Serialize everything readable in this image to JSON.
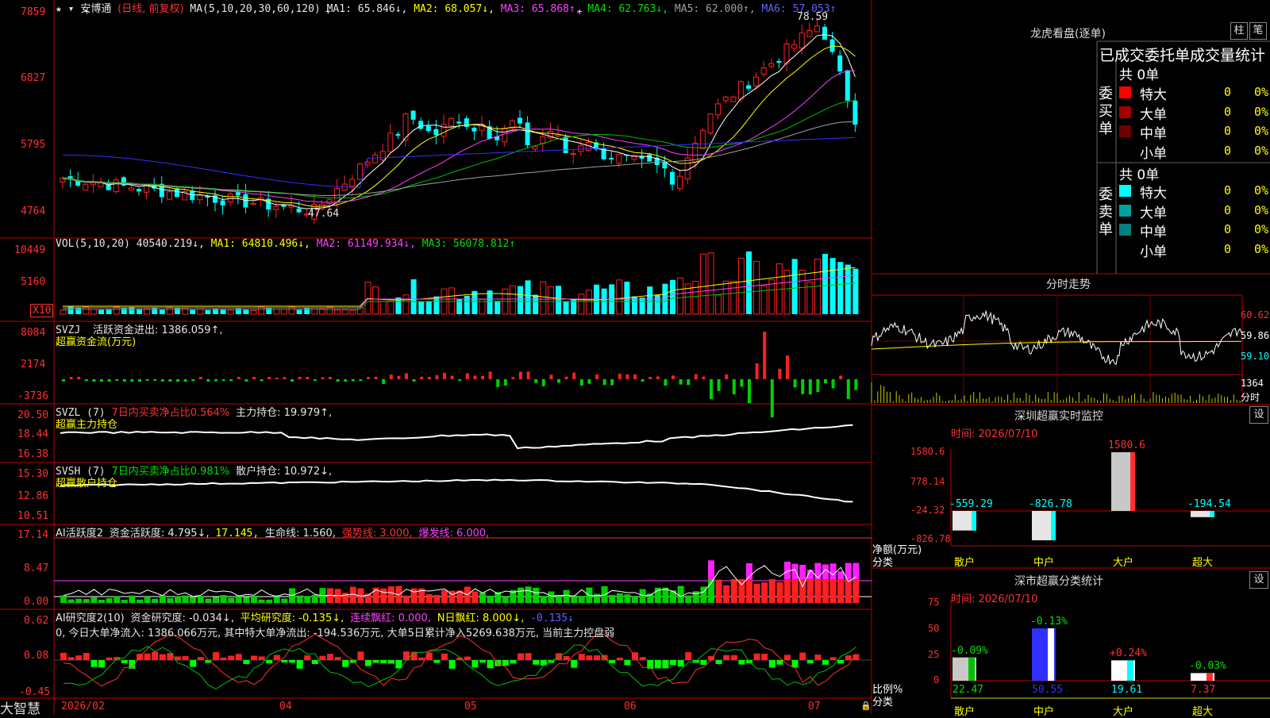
{
  "stock": {
    "name": "安博通",
    "period": "(日线, 前复权)",
    "ma_label": "MA(5,10,20,30,60,120)",
    "ma1": "MA1: 65.846↓,",
    "ma2": "MA2: 68.057↓,",
    "ma3": "MA3: 65.868↑,",
    "ma4": "MA4: 62.763↓,",
    "ma5": "MA5: 62.000↑,",
    "ma6": "MA6: 57.053↑",
    "high_mark": "78.59",
    "low_mark": "47.64",
    "price_axis": [
      "7859",
      "6827",
      "5795",
      "4764"
    ]
  },
  "vol": {
    "label": "VOL(5,10,20)",
    "value": "40540.219↓,",
    "ma1": "MA1: 64810.496↓,",
    "ma2": "MA2: 61149.934↓,",
    "ma3": "MA3: 56078.812↑",
    "axis": [
      "10449",
      "5160"
    ],
    "unit": "X10"
  },
  "svzj": {
    "label": "SVZJ",
    "desc": "活跃资金进出: 1386.059↑,",
    "sub": "超赢资金流(万元)",
    "axis": [
      "8084",
      "2174",
      "-3736"
    ]
  },
  "svzl": {
    "label": "SVZL (7)",
    "desc1": "7日内买卖净占比0.564%",
    "desc2": "主力持仓: 19.979↑,",
    "sub": "超赢主力持仓",
    "axis": [
      "20.50",
      "18.44",
      "16.38"
    ]
  },
  "svsh": {
    "label": "SVSH (7)",
    "desc1": "7日内买卖净占比0.981%",
    "desc2": "散户持仓: 10.972↓,",
    "sub": "超赢散户持仓",
    "axis": [
      "15.30",
      "12.86",
      "10.51"
    ]
  },
  "ai1": {
    "label": "AI活跃度2",
    "v1": "资金活跃度: 4.795↓,",
    "v2": "17.145,",
    "v3": "生命线: 1.560,",
    "v4": "强势线: 3.000,",
    "v5": "爆发线: 6.000,",
    "axis": [
      "17.14",
      "8.47",
      "0.00"
    ]
  },
  "ai2": {
    "label": "AI研究度2(10)",
    "v1": "资金研究度: -0.034↓,",
    "v2": "平均研究度: -0.135↓,",
    "v3": "连续飘红: 0.000,",
    "v4": "N日飘红: 8.000↓,",
    "v5": "-0.135↓",
    "summary": "0, 今日大单净流入: 1386.066万元, 其中特大单净流出: -194.536万元, 大单5日累计净入5269.638万元, 当前主力控盘弱",
    "axis": [
      "0.62",
      "0.08",
      "-0.45"
    ]
  },
  "date_axis": {
    "brand": "大智慧",
    "labels": [
      "2026/02",
      "04",
      "05",
      "06",
      "07"
    ]
  },
  "right": {
    "lhb_title": "龙虎看盘(逐单)",
    "btn_zhu": "柱",
    "btn_bi": "笔",
    "stat_title": "已成交委托单成交量统计",
    "buy": {
      "side": "委买单",
      "total": "共 0单",
      "rows": [
        {
          "name": "特大",
          "v": "0",
          "p": "0%",
          "c": "#ff0000"
        },
        {
          "name": "大单",
          "v": "0",
          "p": "0%",
          "c": "#a00000"
        },
        {
          "name": "中单",
          "v": "0",
          "p": "0%",
          "c": "#700000"
        },
        {
          "name": "小单",
          "v": "0",
          "p": "0%",
          "c": "#000"
        }
      ]
    },
    "sell": {
      "side": "委卖单",
      "total": "共 0单",
      "rows": [
        {
          "name": "特大",
          "v": "0",
          "p": "0%",
          "c": "#00ffff"
        },
        {
          "name": "大单",
          "v": "0",
          "p": "0%",
          "c": "#00a0a0"
        },
        {
          "name": "中单",
          "v": "0",
          "p": "0%",
          "c": "#008080"
        },
        {
          "name": "小单",
          "v": "0",
          "p": "0%",
          "c": "#000"
        }
      ]
    },
    "fs_title": "分时走势",
    "fs_axis": [
      "60.62",
      "59.86",
      "59.10"
    ],
    "fs_vol": "1364",
    "fs_unit": "分时",
    "sz_title": "深圳超赢实时监控",
    "sz_btn": "设",
    "sz_date": "时间: 2026/07/10",
    "sz_axis": [
      "1580.6",
      "778.14",
      "-24.32",
      "-826.78"
    ],
    "sz_ylabel": "净额(万元)",
    "sz_xlabel": "分类",
    "sz_bars": [
      {
        "cat": "散户",
        "v": "-559.29"
      },
      {
        "cat": "中户",
        "v": "-826.78"
      },
      {
        "cat": "大户",
        "v": "1580.6"
      },
      {
        "cat": "超大",
        "v": "-194.54"
      }
    ],
    "cl_title": "深市超赢分类统计",
    "cl_btn": "设",
    "cl_date": "时间: 2026/07/10",
    "cl_axis": [
      "75",
      "50",
      "25",
      "0"
    ],
    "cl_ylabel": "比例%",
    "cl_xlabel": "分类",
    "cl_bars": [
      {
        "cat": "散户",
        "v": "22.47",
        "pct": "-0.09%"
      },
      {
        "cat": "中户",
        "v": "50.55",
        "pct": "-0.13%"
      },
      {
        "cat": "大户",
        "v": "19.61",
        "pct": "+0.24%"
      },
      {
        "cat": "超大",
        "v": "7.37",
        "pct": "-0.03%"
      }
    ]
  }
}
